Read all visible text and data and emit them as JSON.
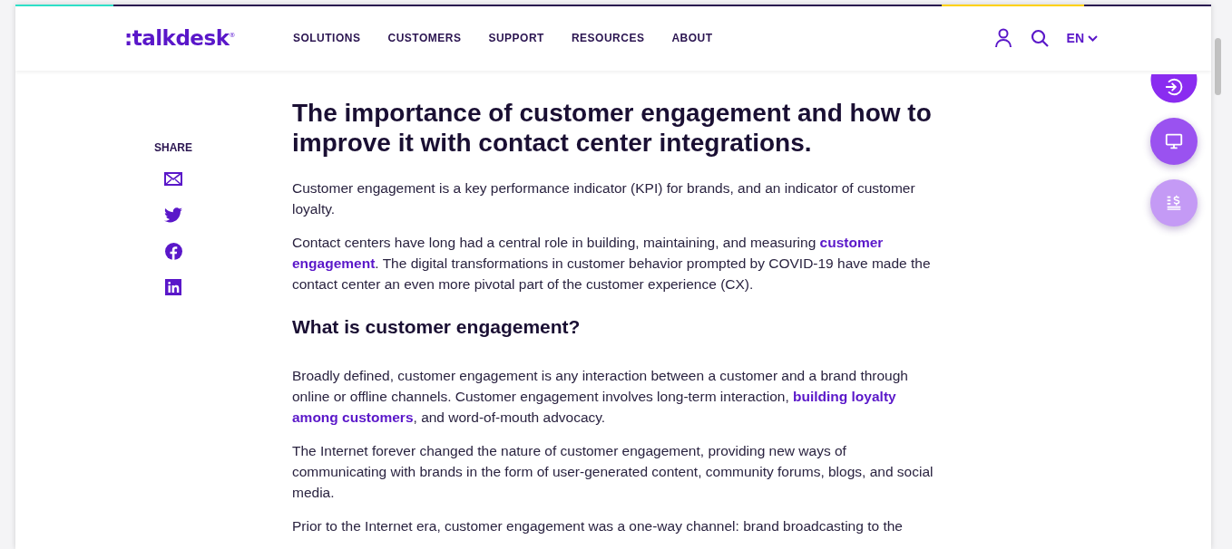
{
  "header": {
    "logo": ":talkdesk",
    "logo_mark": "®",
    "nav": [
      "SOLUTIONS",
      "CUSTOMERS",
      "SUPPORT",
      "RESOURCES",
      "ABOUT"
    ],
    "language": "EN"
  },
  "share": {
    "label": "SHARE",
    "items": [
      {
        "kind": "email"
      },
      {
        "kind": "twitter"
      },
      {
        "kind": "facebook"
      },
      {
        "kind": "linkedin"
      }
    ]
  },
  "article": {
    "title": "The importance of customer engagement and how to improve it with contact center integrations.",
    "blocks": [
      {
        "kind": "paragraph",
        "parts": [
          {
            "text": "Customer engagement is a key performance indicator (KPI) for brands, and an indicator of customer loyalty.",
            "link": false
          }
        ]
      },
      {
        "kind": "paragraph",
        "parts": [
          {
            "text": "Contact centers have long had a central role in building, maintaining, and measuring ",
            "link": false
          },
          {
            "text": "customer",
            "link": true
          },
          {
            "text": "engagement",
            "link": true
          },
          {
            "text": ". The digital transformations in customer behavior prompted by COVID-19 have made the contact center an even more pivotal part of the customer experience (CX).",
            "link": false
          }
        ]
      },
      {
        "kind": "heading",
        "parts": [
          {
            "text": "What is customer engagement?",
            "link": false
          }
        ]
      },
      {
        "kind": "paragraph",
        "parts": [
          {
            "text": "Broadly defined, customer engagement is any interaction between a customer and a brand through online or offline channels. Customer engagement involves long-term interaction, ",
            "link": false
          },
          {
            "text": "building loyalty",
            "link": true
          },
          {
            "text": "among customers",
            "link": true
          },
          {
            "text": ", and word-of-mouth advocacy.",
            "link": false
          }
        ]
      },
      {
        "kind": "paragraph",
        "parts": [
          {
            "text": "The Internet forever changed the nature of customer engagement, providing new ways of communicating with brands in the form of user-generated content, community forums, blogs, and social media.",
            "link": false
          }
        ]
      },
      {
        "kind": "paragraph",
        "parts": [
          {
            "text": "Prior to the Internet era, customer engagement was a one-way channel: brand broadcasting to the",
            "link": false
          }
        ]
      }
    ]
  },
  "floating_buttons": [
    {
      "kind": "login"
    },
    {
      "kind": "demo"
    },
    {
      "kind": "pricing"
    }
  ]
}
